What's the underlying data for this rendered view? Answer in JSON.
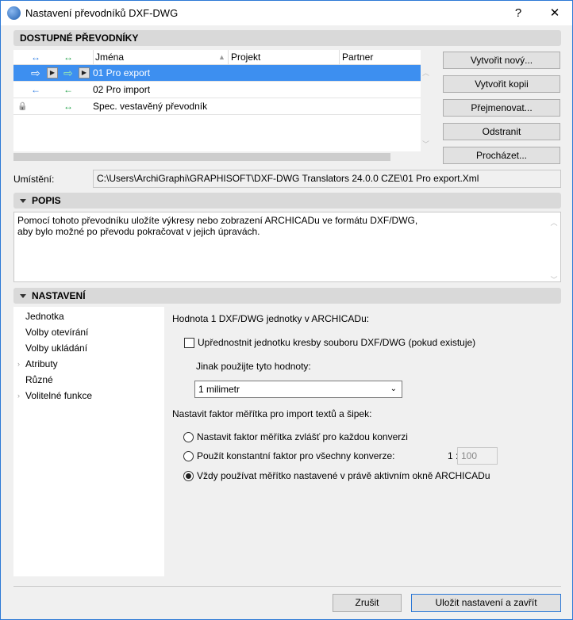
{
  "window": {
    "title": "Nastavení převodníků DXF-DWG",
    "help": "?",
    "close": "✕"
  },
  "translators": {
    "section": "DOSTUPNÉ PŘEVODNÍKY",
    "columns": {
      "names": "Jména",
      "project": "Projekt",
      "partner": "Partner"
    },
    "header_icons": {
      "open": "↔",
      "save": "↔"
    },
    "rows": [
      {
        "name": "01 Pro export",
        "open": "⇨",
        "save": "⇨",
        "selected": true
      },
      {
        "name": "02 Pro import",
        "open": "←",
        "save": "←"
      },
      {
        "name": "Spec. vestavěný převodník",
        "lock": "🔒",
        "save": "↔"
      }
    ],
    "buttons": [
      "Vytvořit nový...",
      "Vytvořit kopii",
      "Přejmenovat...",
      "Odstranit",
      "Procházet..."
    ]
  },
  "location": {
    "label": "Umístění:",
    "value": "C:\\Users\\ArchiGraphi\\GRAPHISOFT\\DXF-DWG Translators 24.0.0 CZE\\01 Pro export.Xml"
  },
  "description": {
    "section": "POPIS",
    "text1": "Pomocí tohoto převodníku uložíte výkresy nebo zobrazení ARCHICADu ve formátu DXF/DWG,",
    "text2": "aby bylo možné po převodu pokračovat v jejich úpravách."
  },
  "settings": {
    "section": "NASTAVENÍ",
    "nav": [
      {
        "label": "Jednotka"
      },
      {
        "label": "Volby otevírání"
      },
      {
        "label": "Volby ukládání"
      },
      {
        "label": "Atributy",
        "expandable": true
      },
      {
        "label": "Různé"
      },
      {
        "label": "Volitelné funkce",
        "expandable": true
      }
    ],
    "unit_heading": "Hodnota 1 DXF/DWG jednotky v ARCHICADu:",
    "prefer_checkbox": "Upřednostnit jednotku kresby souboru DXF/DWG (pokud existuje)",
    "prefer_checked": false,
    "otherwise": "Jinak použijte tyto hodnoty:",
    "unit_value": "1 milimetr",
    "scale_heading": "Nastavit faktor měřítka pro import textů a šipek:",
    "radios": [
      "Nastavit faktor měřítka zvlášť pro každou konverzi",
      "Použít konstantní faktor pro všechny konverze:",
      "Vždy používat měřítko nastavené v právě aktivním okně ARCHICADu"
    ],
    "radio_selected": 2,
    "ratio_prefix": "1 :",
    "ratio_value": "100"
  },
  "footer": {
    "cancel": "Zrušit",
    "save": "Uložit nastavení a zavřít"
  }
}
